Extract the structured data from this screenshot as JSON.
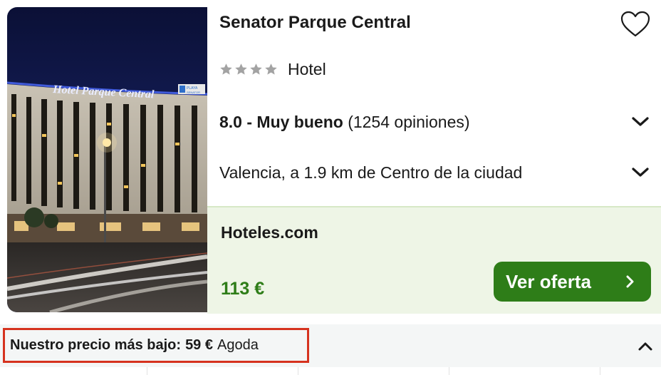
{
  "hotel": {
    "name": "Senator Parque Central",
    "star_rating": 4,
    "type": "Hotel",
    "rating_score": "8.0 - Muy bueno",
    "rating_reviews": "(1254 opiniones)",
    "location": "Valencia, a 1.9 km de Centro de la ciudad",
    "photo_signage": {
      "main_sign": "Hotel Parque Central",
      "side_sign_line1": "PLAYA",
      "side_sign_line2": "SENATOR"
    }
  },
  "deal": {
    "provider": "Hoteles.com",
    "price": "113 €",
    "cta_label": "Ver oferta"
  },
  "lowest_price": {
    "label": "Nuestro precio más bajo:",
    "price": "59 €",
    "provider": "Agoda"
  },
  "colors": {
    "accent_green": "#2e7d18",
    "deal_background": "#eef5e6",
    "highlight_border": "#d6331f",
    "star_gray": "#a3a3a3"
  },
  "icons": {
    "favorite": "heart-outline-icon",
    "expand": "chevron-down-icon",
    "collapse": "chevron-up-icon",
    "cta": "chevron-right-icon",
    "star": "star-icon"
  }
}
